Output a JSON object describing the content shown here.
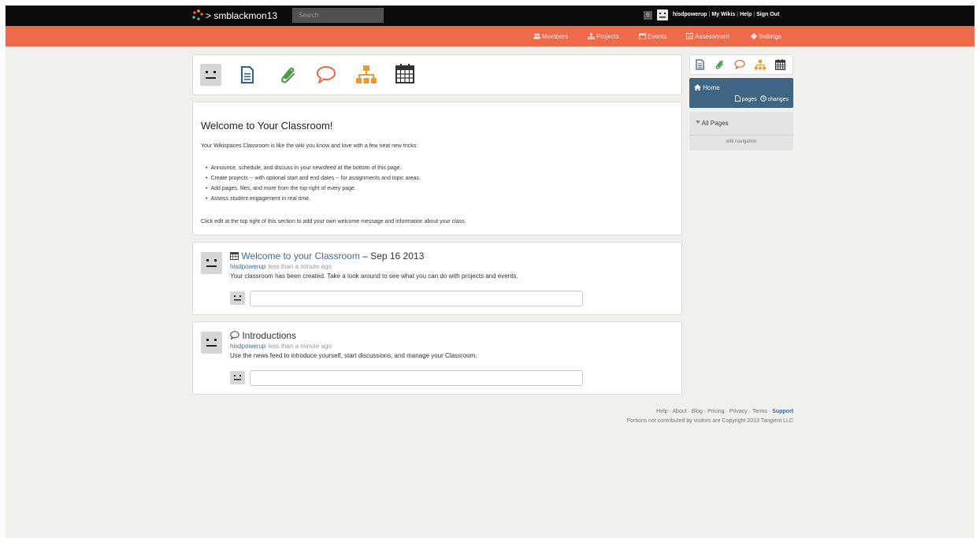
{
  "topbar": {
    "wiki_name": "> smblackmon13",
    "search_placeholder": "Search",
    "notification_count": "0",
    "username": "hisdpowerup",
    "my_wikis": "My Wikis",
    "help": "Help",
    "sign_out": "Sign Out"
  },
  "nav": {
    "members": "Members",
    "projects": "Projects",
    "events": "Events",
    "assessment": "Assessment",
    "settings": "Settings",
    "bar_color": "#ee6a4b"
  },
  "welcome": {
    "title": "Welcome to Your Classroom!",
    "intro": "Your Wikispaces Classroom is like the wiki you know and love with a few neat new tricks:",
    "items": [
      "Announce, schedule, and discuss in your newsfeed at the bottom of this page.",
      "Create projects -- with optional start and end dates -- for assignments and topic areas.",
      "Add pages, files, and more from the top right of every page.",
      "Assess student engagement in real time."
    ],
    "footer": "Click edit at the top right of this section to add your own welcome message and information about your class."
  },
  "feed": [
    {
      "icon": "calendar-icon",
      "title": "Welcome to your Classroom",
      "date": " – Sep 16 2013",
      "user": "hisdpowerup",
      "time": "less than a minute ago",
      "body": "Your classroom has been created. Take a look around to see what you can do with projects and events."
    },
    {
      "icon": "speech-bubble-icon",
      "title": "Introductions",
      "date": "",
      "user": "hisdpowerup",
      "time": "less than a minute ago",
      "body": "Use the news feed to introduce yourself, start discussions, and manage your Classroom."
    }
  ],
  "sidebar": {
    "home": "Home",
    "pages": "pages",
    "changes": "changes",
    "all_pages": "All Pages",
    "edit_navigation": "edit navigation"
  },
  "footer": {
    "help": "Help",
    "about": "About",
    "blog": "Blog",
    "pricing": "Pricing",
    "privacy": "Privacy",
    "terms": "Terms",
    "support": "Support",
    "copyright": "Portions not contributed by visitors are Copyright 2013 Tangient LLC"
  },
  "colors": {
    "topbar": "#0c0c0c",
    "accent_blue": "#3e6582",
    "link": "#3d6b9f",
    "doc_icon": "#2f5f8c",
    "clip_icon": "#4f9a48",
    "chat_icon": "#e86a3e",
    "project_icon": "#ec9a2f",
    "calendar_icon": "#333333"
  }
}
